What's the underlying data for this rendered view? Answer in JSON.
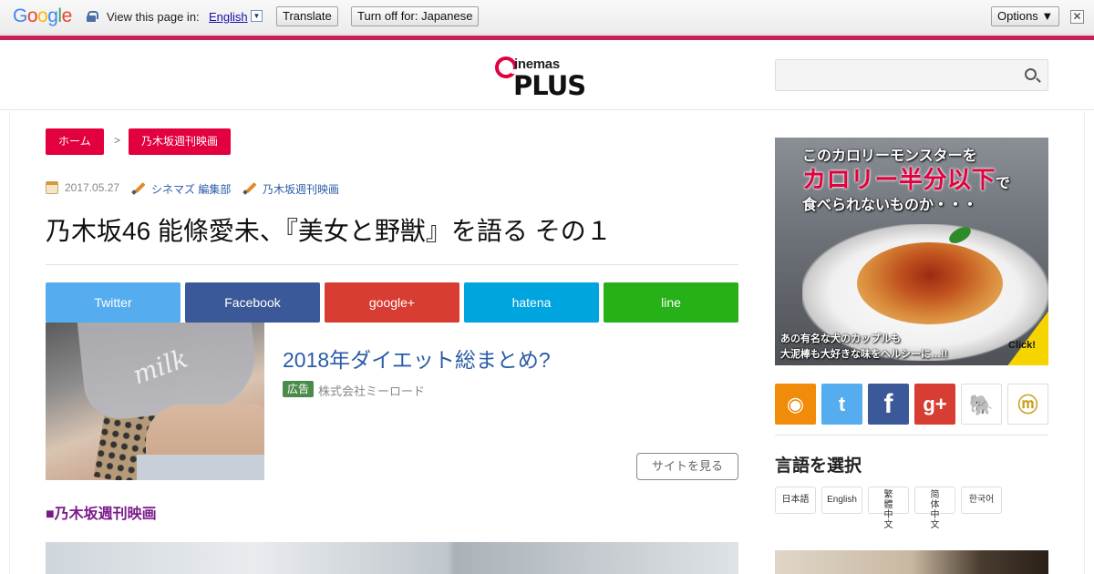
{
  "translate_bar": {
    "brand": "Google",
    "view_text": "View this page in:",
    "language": "English",
    "language_dropdown": "▼",
    "translate_button": "Translate",
    "turn_off_button": "Turn off for: Japanese",
    "options_button": "Options ▼",
    "close": "✕"
  },
  "header": {
    "logo_top": "inemas",
    "logo_bottom": "PLUS",
    "search_placeholder": ""
  },
  "breadcrumb": {
    "home": "ホーム",
    "separator": ">",
    "category": "乃木坂週刊映画"
  },
  "article": {
    "date": "2017.05.27",
    "author": "シネマズ 編集部",
    "tag": "乃木坂週刊映画",
    "title": "乃木坂46 能條愛未、『美女と野獣』を語る その１"
  },
  "share": [
    {
      "label": "Twitter",
      "color": "#55acee"
    },
    {
      "label": "Facebook",
      "color": "#3b5998"
    },
    {
      "label": "google+",
      "color": "#d73d32"
    },
    {
      "label": "hatena",
      "color": "#00a4de"
    },
    {
      "label": "line",
      "color": "#25b117"
    }
  ],
  "ad": {
    "image_text": "milk",
    "title": "2018年ダイエット総まとめ?",
    "badge": "広告",
    "sponsor": "株式会社ミーロード",
    "button": "サイトを見る"
  },
  "section_heading": "■乃木坂週刊映画",
  "sidebar": {
    "banner": {
      "line1": "このカロリーモンスターを",
      "line2": "カロリー半分以下",
      "line2_suffix": "で",
      "line3": "食べられないものか・・・",
      "bottom1": "あの有名な犬のカップルも",
      "bottom2": "大泥棒も大好きな味をヘルシーに…!!",
      "click": "Click!"
    },
    "sns": [
      {
        "icon": "rss-icon",
        "glyph": "◉",
        "color": "#f08c0a"
      },
      {
        "icon": "twitter-icon",
        "glyph": "t",
        "color": "#55acee"
      },
      {
        "icon": "facebook-icon",
        "glyph": "f",
        "color": "#3b5998"
      },
      {
        "icon": "googleplus-icon",
        "glyph": "g+",
        "color": "#d73d32"
      },
      {
        "icon": "evernote-icon",
        "glyph": "🐘",
        "color": "#ffffff"
      },
      {
        "icon": "mixi-icon",
        "glyph": "ⓜ",
        "color": "#ffffff"
      }
    ],
    "language_heading": "言語を選択",
    "languages": [
      "日本語",
      "English",
      "繁體中文",
      "简体中文",
      "한국어"
    ]
  }
}
